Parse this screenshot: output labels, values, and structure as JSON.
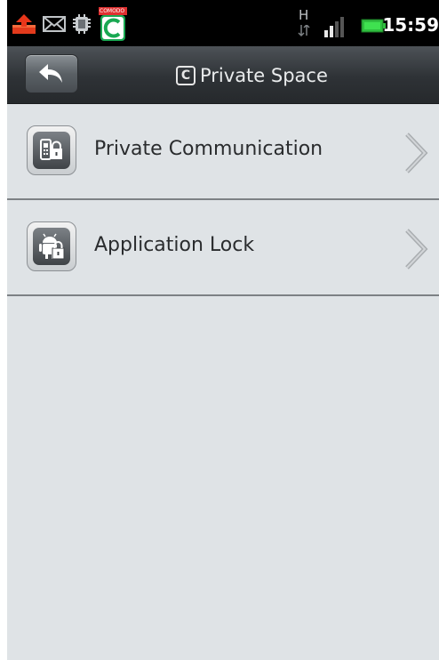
{
  "status_bar": {
    "time": "15:59",
    "network_label": "H",
    "icons": [
      "upload-notification-icon",
      "mail-icon",
      "usb-icon",
      "comodo-app-icon",
      "network-h-icon",
      "signal-icon",
      "battery-icon"
    ],
    "app_badge_text": "COMODO"
  },
  "titlebar": {
    "title": "Private Space",
    "logo_letter": "C",
    "back_icon": "back-arrow-icon"
  },
  "menu": {
    "items": [
      {
        "label": "Private Communication",
        "icon": "phone-lock-icon"
      },
      {
        "label": "Application Lock",
        "icon": "android-lock-icon"
      }
    ]
  },
  "colors": {
    "background": "#dfe3e6",
    "titlebar": "#2e3236",
    "divider": "#7d8185",
    "text": "#2a2c2e"
  }
}
